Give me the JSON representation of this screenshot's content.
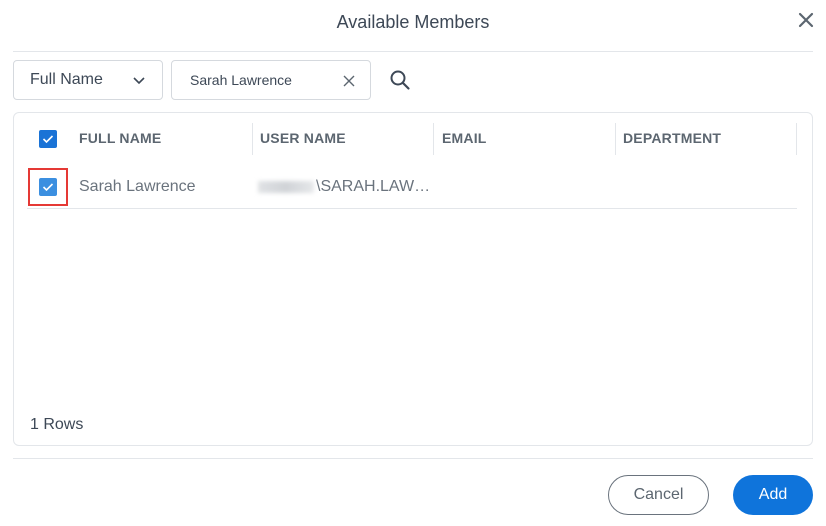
{
  "dialog": {
    "title": "Available Members",
    "close_icon": "close-icon"
  },
  "filter": {
    "field_select": "Full Name",
    "search_value": "Sarah Lawrence",
    "search_placeholder": "",
    "clear_icon": "clear-icon",
    "search_icon": "search-icon"
  },
  "table": {
    "select_all_checked": true,
    "columns": [
      "FULL NAME",
      "USER NAME",
      "EMAIL",
      "DEPARTMENT"
    ],
    "rows": [
      {
        "checked": true,
        "full_name": "Sarah Lawrence",
        "user_name": "\\SARAH.LAW…",
        "user_name_prefix_blurred": true,
        "email": "",
        "department": ""
      }
    ],
    "rows_count": "1 Rows"
  },
  "footer": {
    "cancel_label": "Cancel",
    "add_label": "Add"
  },
  "colors": {
    "primary": "#0f74db",
    "highlight_border": "#e53935"
  }
}
